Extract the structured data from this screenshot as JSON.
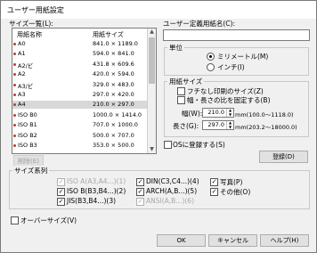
{
  "window": {
    "title": "ユーザー用紙設定"
  },
  "size_list": {
    "label": "サイズ一覧(L):",
    "columns": [
      "用紙名称",
      "用紙サイズ"
    ],
    "rows": [
      {
        "name": "A0",
        "size": "841.0 × 1189.0"
      },
      {
        "name": "A1",
        "size": "594.0 × 841.0"
      },
      {
        "name": "A2/ビ",
        "size": "431.8 × 609.6"
      },
      {
        "name": "A2",
        "size": "420.0 × 594.0"
      },
      {
        "name": "A3/ビ",
        "size": "329.0 × 483.0"
      },
      {
        "name": "A3",
        "size": "297.0 × 420.0"
      },
      {
        "name": "A4",
        "size": "210.0 × 297.0"
      },
      {
        "name": "ISO B0",
        "size": "1000.0 × 1414.0"
      },
      {
        "name": "ISO B1",
        "size": "707.0 × 1000.0"
      },
      {
        "name": "ISO B2",
        "size": "500.0 × 707.0"
      },
      {
        "name": "ISO B3",
        "size": "353.0 × 500.0"
      }
    ]
  },
  "delete_button": "削除(E)",
  "user_name": {
    "label": "ユーザー定義用紙名(C):",
    "value": ""
  },
  "unit": {
    "label": "単位",
    "millimeter": "ミリメートル(M)",
    "inch": "インチ(I)"
  },
  "paper_size": {
    "label": "用紙サイズ",
    "fit_print": "フチなし印刷のサイズ(Z)",
    "fix_ratio": "幅・長さの比を固定する(B)",
    "width_label": "幅(W):",
    "width_value": "210.0",
    "width_range": "mm(100.0〜1118.0)",
    "length_label": "長さ(G):",
    "length_value": "297.0",
    "length_range": "mm(203.2〜18000.0)"
  },
  "os_register": "OSに登録する(S)",
  "register_button": "登録(D)",
  "series": {
    "label": "サイズ系列",
    "iso_a": "ISO A(A3,A4...)(1)",
    "iso_b": "ISO B(B3,B4...)(2)",
    "jis_b": "JIS(B3,B4...)(3)",
    "din": "DIN(C3,C4...)(4)",
    "arch": "ARCH(A,B...)(5)",
    "ansi": "ANSI(A,B...)(6)",
    "photo": "写真(P)",
    "other": "その他(O)"
  },
  "oversize": "オーバーサイズ(V)",
  "buttons": {
    "ok": "OK",
    "cancel": "キャンセル",
    "help": "ヘルプ(H)"
  }
}
